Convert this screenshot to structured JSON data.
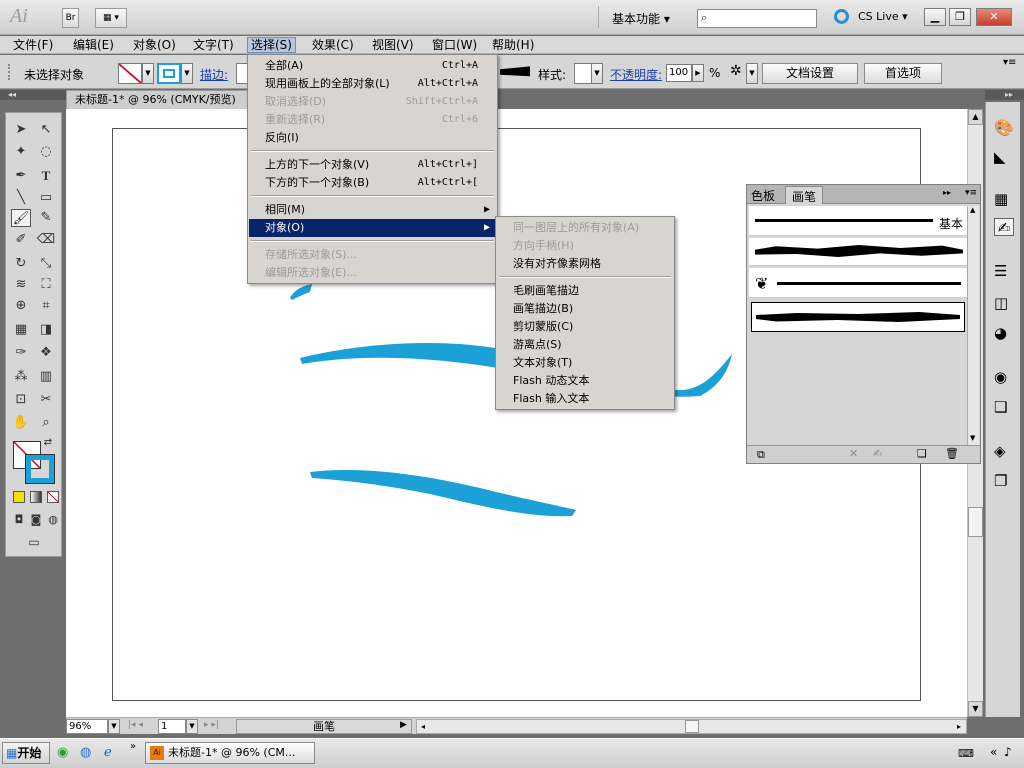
{
  "app": {
    "logo": "Ai",
    "bridge": "Br",
    "workspace": "基本功能",
    "cslive": "CS Live"
  },
  "menus": [
    "文件(F)",
    "编辑(E)",
    "对象(O)",
    "文字(T)",
    "选择(S)",
    "效果(C)",
    "视图(V)",
    "窗口(W)",
    "帮助(H)"
  ],
  "control": {
    "no_selection": "未选择对象",
    "stroke_label": "描边:",
    "style_label": "样式:",
    "opacity_label": "不透明度:",
    "opacity_value": "100",
    "opacity_unit": "%",
    "doc_settings": "文档设置",
    "prefs": "首选项"
  },
  "document": {
    "tab": "未标题-1* @ 96% (CMYK/预览)"
  },
  "select_menu": [
    {
      "label": "全部(A)",
      "shortcut": "Ctrl+A",
      "disabled": false
    },
    {
      "label": "现用画板上的全部对象(L)",
      "shortcut": "Alt+Ctrl+A",
      "disabled": false
    },
    {
      "label": "取消选择(D)",
      "shortcut": "Shift+Ctrl+A",
      "disabled": true
    },
    {
      "label": "重新选择(R)",
      "shortcut": "Ctrl+6",
      "disabled": true
    },
    {
      "label": "反向(I)",
      "shortcut": "",
      "disabled": false
    },
    {
      "label": "上方的下一个对象(V)",
      "shortcut": "Alt+Ctrl+]",
      "disabled": false
    },
    {
      "label": "下方的下一个对象(B)",
      "shortcut": "Alt+Ctrl+[",
      "disabled": false
    },
    {
      "label": "相同(M)",
      "shortcut": "",
      "disabled": false
    },
    {
      "label": "对象(O)",
      "shortcut": "",
      "disabled": false
    },
    {
      "label": "存储所选对象(S)...",
      "shortcut": "",
      "disabled": true
    },
    {
      "label": "编辑所选对象(E)...",
      "shortcut": "",
      "disabled": true
    }
  ],
  "object_submenu": [
    {
      "label": "同一图层上的所有对象(A)",
      "disabled": true
    },
    {
      "label": "方向手柄(H)",
      "disabled": true
    },
    {
      "label": "没有对齐像素网格",
      "disabled": false
    },
    {
      "label": "毛刷画笔描边",
      "disabled": false
    },
    {
      "label": "画笔描边(B)",
      "disabled": false
    },
    {
      "label": "剪切蒙版(C)",
      "disabled": false
    },
    {
      "label": "游离点(S)",
      "disabled": false
    },
    {
      "label": "文本对象(T)",
      "disabled": false
    },
    {
      "label": "Flash 动态文本",
      "disabled": false
    },
    {
      "label": "Flash 输入文本",
      "disabled": false
    }
  ],
  "brush_panel": {
    "tabs": [
      "色板",
      "画笔"
    ],
    "basic_label": "基本"
  },
  "status": {
    "zoom": "96%",
    "artboard": "1",
    "tool_label": "画笔"
  },
  "taskbar": {
    "start": "开始",
    "task": "未标题-1* @ 96% (CM..."
  },
  "colors": {
    "accent": "#1ba1d8",
    "menu_highlight": "#0a246a"
  }
}
